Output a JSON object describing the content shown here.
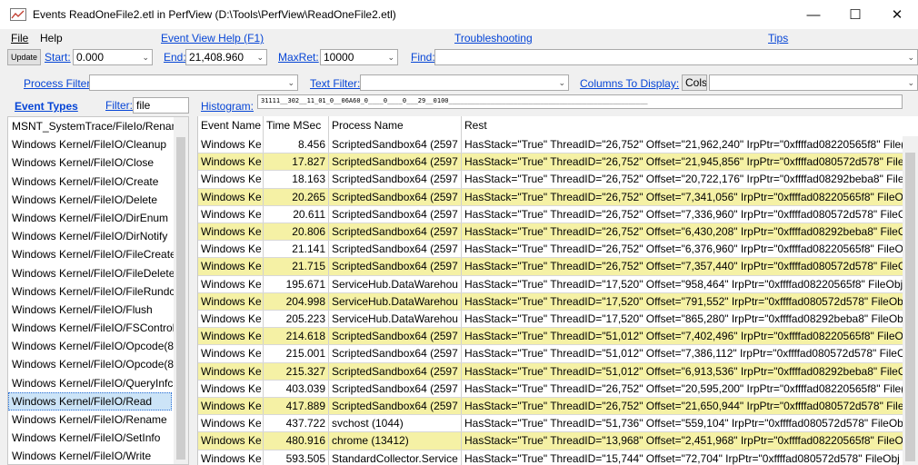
{
  "window": {
    "title": "Events ReadOneFile2.etl in PerfView (D:\\Tools\\PerfView\\ReadOneFile2.etl)",
    "minimize": "—",
    "maximize": "☐",
    "close": "✕"
  },
  "menu": {
    "file": "File",
    "help": "Help",
    "event_view_help": "Event View Help (F1)",
    "troubleshooting": "Troubleshooting",
    "tips": "Tips"
  },
  "toolbar": {
    "update": "Update",
    "start_label": "Start:",
    "start_value": "0.000",
    "end_label": "End:",
    "end_value": "21,408.960",
    "maxret_label": "MaxRet:",
    "maxret_value": "10000",
    "find_label": "Find:",
    "find_value": ""
  },
  "filters": {
    "process_filter_label": "Process Filter:",
    "process_filter_value": "",
    "text_filter_label": "Text Filter:",
    "text_filter_value": "",
    "columns_label": "Columns To Display:",
    "columns_button": "Cols",
    "columns_value": ""
  },
  "event_types_bar": {
    "label": "Event Types",
    "filter_label": "Filter:",
    "filter_value": "file",
    "histogram_label": "Histogram:",
    "histogram_value": "31111__302__11_01_0__06A60_0____0____0___29__0100____________________________________________________"
  },
  "event_types": [
    "MSNT_SystemTrace/FileIo/Renam",
    "Windows Kernel/FileIO/Cleanup",
    "Windows Kernel/FileIO/Close",
    "Windows Kernel/FileIO/Create",
    "Windows Kernel/FileIO/Delete",
    "Windows Kernel/FileIO/DirEnum",
    "Windows Kernel/FileIO/DirNotify",
    "Windows Kernel/FileIO/FileCreate",
    "Windows Kernel/FileIO/FileDelete",
    "Windows Kernel/FileIO/FileRundc",
    "Windows Kernel/FileIO/Flush",
    "Windows Kernel/FileIO/FSControl",
    "Windows Kernel/FileIO/Opcode(8",
    "Windows Kernel/FileIO/Opcode(8",
    "Windows Kernel/FileIO/QueryInfc",
    "Windows Kernel/FileIO/Read",
    "Windows Kernel/FileIO/Rename",
    "Windows Kernel/FileIO/SetInfo",
    "Windows Kernel/FileIO/Write"
  ],
  "selected_event_type_index": 15,
  "grid": {
    "columns": [
      "Event Name",
      "Time MSec",
      "Process Name",
      "Rest"
    ],
    "rows": [
      {
        "name": "Windows Ke",
        "time": "8.456",
        "process": "ScriptedSandbox64 (2597",
        "rest": "HasStack=\"True\" ThreadID=\"26,752\" Offset=\"21,962,240\" IrpPtr=\"0xffffad08220565f8\" File(",
        "hl": false
      },
      {
        "name": "Windows Ke",
        "time": "17.827",
        "process": "ScriptedSandbox64 (2597",
        "rest": "HasStack=\"True\" ThreadID=\"26,752\" Offset=\"21,945,856\" IrpPtr=\"0xffffad080572d578\" File",
        "hl": true
      },
      {
        "name": "Windows Ke",
        "time": "18.163",
        "process": "ScriptedSandbox64 (2597",
        "rest": "HasStack=\"True\" ThreadID=\"26,752\" Offset=\"20,722,176\" IrpPtr=\"0xffffad08292beba8\" File",
        "hl": false
      },
      {
        "name": "Windows Ke",
        "time": "20.265",
        "process": "ScriptedSandbox64 (2597",
        "rest": "HasStack=\"True\" ThreadID=\"26,752\" Offset=\"7,341,056\" IrpPtr=\"0xffffad08220565f8\" FileO",
        "hl": true
      },
      {
        "name": "Windows Ke",
        "time": "20.611",
        "process": "ScriptedSandbox64 (2597",
        "rest": "HasStack=\"True\" ThreadID=\"26,752\" Offset=\"7,336,960\" IrpPtr=\"0xffffad080572d578\" FileC",
        "hl": false
      },
      {
        "name": "Windows Ke",
        "time": "20.806",
        "process": "ScriptedSandbox64 (2597",
        "rest": "HasStack=\"True\" ThreadID=\"26,752\" Offset=\"6,430,208\" IrpPtr=\"0xffffad08292beba8\" FileC",
        "hl": true
      },
      {
        "name": "Windows Ke",
        "time": "21.141",
        "process": "ScriptedSandbox64 (2597",
        "rest": "HasStack=\"True\" ThreadID=\"26,752\" Offset=\"6,376,960\" IrpPtr=\"0xffffad08220565f8\" FileO",
        "hl": false
      },
      {
        "name": "Windows Ke",
        "time": "21.715",
        "process": "ScriptedSandbox64 (2597",
        "rest": "HasStack=\"True\" ThreadID=\"26,752\" Offset=\"7,357,440\" IrpPtr=\"0xffffad080572d578\" FileC",
        "hl": true
      },
      {
        "name": "Windows Ke",
        "time": "195.671",
        "process": "ServiceHub.DataWarehou",
        "rest": "HasStack=\"True\" ThreadID=\"17,520\" Offset=\"958,464\" IrpPtr=\"0xffffad08220565f8\" FileObj",
        "hl": false
      },
      {
        "name": "Windows Ke",
        "time": "204.998",
        "process": "ServiceHub.DataWarehou",
        "rest": "HasStack=\"True\" ThreadID=\"17,520\" Offset=\"791,552\" IrpPtr=\"0xffffad080572d578\" FileOb",
        "hl": true
      },
      {
        "name": "Windows Ke",
        "time": "205.223",
        "process": "ServiceHub.DataWarehou",
        "rest": "HasStack=\"True\" ThreadID=\"17,520\" Offset=\"865,280\" IrpPtr=\"0xffffad08292beba8\" FileOb",
        "hl": false
      },
      {
        "name": "Windows Ke",
        "time": "214.618",
        "process": "ScriptedSandbox64 (2597",
        "rest": "HasStack=\"True\" ThreadID=\"51,012\" Offset=\"7,402,496\" IrpPtr=\"0xffffad08220565f8\" FileO",
        "hl": true
      },
      {
        "name": "Windows Ke",
        "time": "215.001",
        "process": "ScriptedSandbox64 (2597",
        "rest": "HasStack=\"True\" ThreadID=\"51,012\" Offset=\"7,386,112\" IrpPtr=\"0xffffad080572d578\" FileC",
        "hl": false
      },
      {
        "name": "Windows Ke",
        "time": "215.327",
        "process": "ScriptedSandbox64 (2597",
        "rest": "HasStack=\"True\" ThreadID=\"51,012\" Offset=\"6,913,536\" IrpPtr=\"0xffffad08292beba8\" FileC",
        "hl": true
      },
      {
        "name": "Windows Ke",
        "time": "403.039",
        "process": "ScriptedSandbox64 (2597",
        "rest": "HasStack=\"True\" ThreadID=\"26,752\" Offset=\"20,595,200\" IrpPtr=\"0xffffad08220565f8\" File(",
        "hl": false
      },
      {
        "name": "Windows Ke",
        "time": "417.889",
        "process": "ScriptedSandbox64 (2597",
        "rest": "HasStack=\"True\" ThreadID=\"26,752\" Offset=\"21,650,944\" IrpPtr=\"0xffffad080572d578\" File",
        "hl": true
      },
      {
        "name": "Windows Ke",
        "time": "437.722",
        "process": "svchost (1044)",
        "rest": "HasStack=\"True\" ThreadID=\"51,736\" Offset=\"559,104\" IrpPtr=\"0xffffad080572d578\" FileOb",
        "hl": false
      },
      {
        "name": "Windows Ke",
        "time": "480.916",
        "process": "chrome (13412)",
        "rest": "HasStack=\"True\" ThreadID=\"13,968\" Offset=\"2,451,968\" IrpPtr=\"0xffffad08220565f8\" FileObj",
        "hl": true
      },
      {
        "name": "Windows Ke",
        "time": "593.505",
        "process": "StandardCollector.Service",
        "rest": "HasStack=\"True\" ThreadID=\"15,744\" Offset=\"72,704\" IrpPtr=\"0xffffad080572d578\" FileObj",
        "hl": false
      }
    ]
  },
  "colors": {
    "link": "#0645d6",
    "row_highlight": "#f5f1a5",
    "row_normal": "#ffffff",
    "selection": "#cce4f7"
  }
}
